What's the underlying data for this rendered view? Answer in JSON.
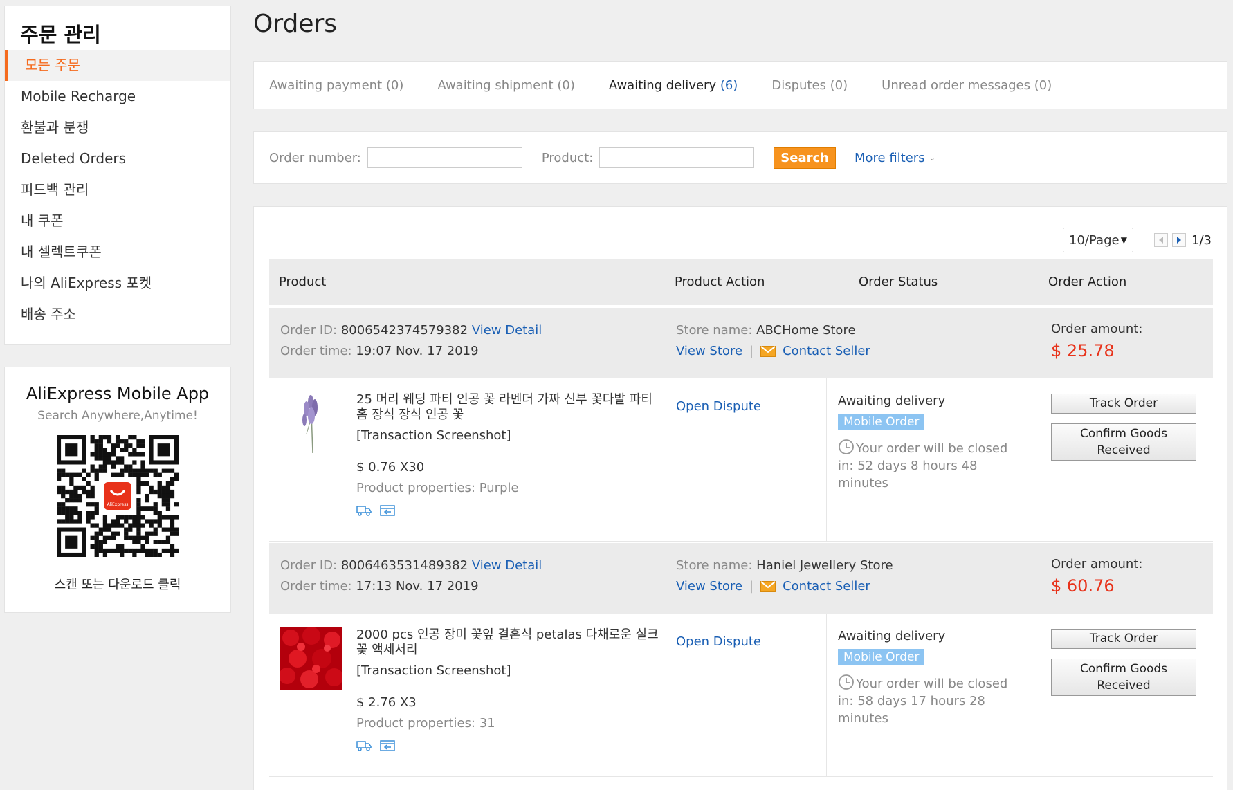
{
  "sidebar": {
    "title": "주문 관리",
    "items": [
      {
        "label": "모든 주문",
        "active": true
      },
      {
        "label": "Mobile Recharge"
      },
      {
        "label": "환불과 분쟁"
      },
      {
        "label": "Deleted Orders"
      },
      {
        "label": "피드백 관리"
      },
      {
        "label": "내 쿠폰"
      },
      {
        "label": "내 셀렉트쿠폰"
      },
      {
        "label": "나의 AliExpress 포켓"
      },
      {
        "label": "배송 주소"
      }
    ]
  },
  "app_promo": {
    "title": "AliExpress Mobile App",
    "subtitle": "Search Anywhere,Anytime!",
    "qr_logo_text": "AliExpress",
    "footer": "스캔 또는 다운로드 클릭"
  },
  "page": {
    "title": "Orders"
  },
  "tabs": [
    {
      "label": "Awaiting payment",
      "count": "(0)"
    },
    {
      "label": "Awaiting shipment",
      "count": "(0)"
    },
    {
      "label": "Awaiting delivery",
      "count": "(6)",
      "active": true
    },
    {
      "label": "Disputes",
      "count": "(0)"
    },
    {
      "label": "Unread order messages",
      "count": "(0)"
    }
  ],
  "filters": {
    "order_number_label": "Order number:",
    "order_number_value": "",
    "product_label": "Product:",
    "product_value": "",
    "search_label": "Search",
    "more_filters_label": "More filters"
  },
  "pagination": {
    "per_page": "10/Page",
    "page": "1/3"
  },
  "table_headers": {
    "product": "Product",
    "product_action": "Product Action",
    "order_status": "Order Status",
    "order_action": "Order Action"
  },
  "labels": {
    "order_id": "Order ID:",
    "order_time": "Order time:",
    "view_detail": "View Detail",
    "store_name": "Store name:",
    "view_store": "View Store",
    "sep": "|",
    "contact_seller": "Contact Seller",
    "order_amount": "Order amount:",
    "open_dispute": "Open Dispute",
    "transaction_screenshot": "[Transaction Screenshot]",
    "product_properties": "Product properties:",
    "mobile_order": "Mobile Order",
    "track_order": "Track Order",
    "confirm_line1": "Confirm Goods",
    "confirm_line2": "Received"
  },
  "orders": [
    {
      "id": "8006542374579382",
      "time": "19:07 Nov. 17 2019",
      "store": "ABCHome Store",
      "amount": "$ 25.78",
      "product_title": "25 머리 웨딩 파티 인공 꽃 라벤더 가짜 신부 꽃다발 파티 홈 장식 장식 인공 꽃",
      "price": "$ 0.76 X30",
      "properties": "Purple",
      "status": "Awaiting delivery",
      "countdown": "Your order will be closed in: 52 days 8 hours 48 minutes"
    },
    {
      "id": "8006463531489382",
      "time": "17:13 Nov. 17 2019",
      "store": "Haniel Jewellery Store",
      "amount": "$ 60.76",
      "product_title": "2000 pcs 인공 장미 꽃잎 결혼식 petalas 다채로운 실크 꽃 액세서리",
      "price": "$ 2.76 X3",
      "properties": "31",
      "status": "Awaiting delivery",
      "countdown": "Your order will be closed in: 58 days 17 hours 28 minutes"
    }
  ],
  "colors": {
    "accent": "#f56b1e",
    "link": "#1a5fb4",
    "price": "#e8321a",
    "search_btn": "#f7931e",
    "badge": "#8cc4f2"
  }
}
